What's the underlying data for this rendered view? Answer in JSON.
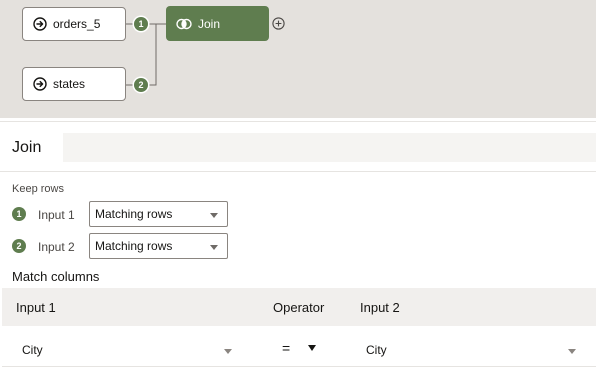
{
  "flow": {
    "nodes": [
      {
        "label": "orders_5",
        "icon": "arrow-circle-right-icon"
      },
      {
        "label": "states",
        "icon": "arrow-circle-right-icon"
      }
    ],
    "join_node": {
      "label": "Join",
      "icon": "join-icon",
      "color": "#5f7d4f"
    },
    "ports": [
      "1",
      "2"
    ],
    "add_icon": "plus-circle-icon"
  },
  "panel": {
    "title": "Join",
    "description_value": "",
    "keep_rows_label": "Keep rows",
    "inputs": [
      {
        "badge": "1",
        "label": "Input 1",
        "selected": "Matching rows"
      },
      {
        "badge": "2",
        "label": "Input 2",
        "selected": "Matching rows"
      }
    ],
    "match_columns_label": "Match columns",
    "table": {
      "headers": {
        "input1": "Input 1",
        "operator": "Operator",
        "input2": "Input 2"
      },
      "rows": [
        {
          "input1": "City",
          "operator": "=",
          "input2": "City"
        }
      ]
    }
  },
  "colors": {
    "accent": "#5f7d4f",
    "canvas_bg": "#e4e1dd"
  }
}
